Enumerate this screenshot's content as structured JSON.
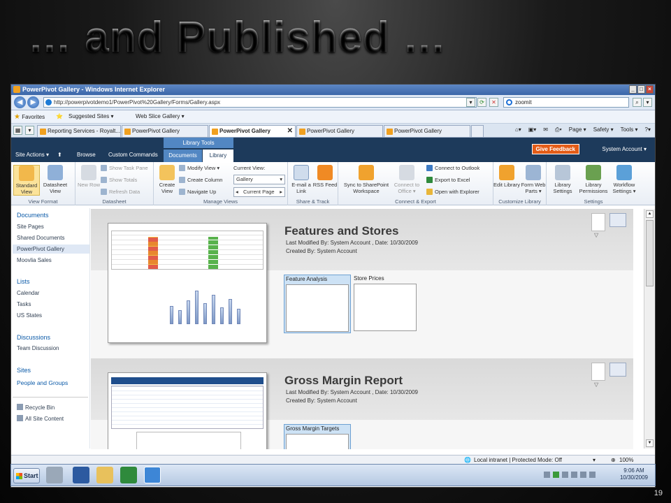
{
  "slide": {
    "title": "… and Published …",
    "number": "19"
  },
  "browser": {
    "window_title": "PowerPivot Gallery - Windows Internet Explorer",
    "url": "http://powerpivotdemo1/PowerPivot%20Gallery/Forms/Gallery.aspx",
    "search_value": "zoomit",
    "favorites_label": "Favorites",
    "suggested_sites": "Suggested Sites ▾",
    "web_slice": "Web Slice Gallery ▾",
    "tabs": [
      {
        "label": "Reporting Services - Royalt..."
      },
      {
        "label": "PowerPivot Gallery"
      },
      {
        "label": "PowerPivot Gallery"
      },
      {
        "label": "PowerPivot Gallery"
      },
      {
        "label": "PowerPivot Gallery"
      }
    ],
    "command_bar": {
      "page": "Page ▾",
      "safety": "Safety ▾",
      "tools": "Tools ▾"
    }
  },
  "sharepoint": {
    "site_actions": "Site Actions ▾",
    "library_tools": "Library Tools",
    "tab_browse": "Browse",
    "tab_custom": "Custom Commands",
    "tab_documents": "Documents",
    "tab_library": "Library",
    "give_feedback": "Give Feedback",
    "user": "System Account ▾"
  },
  "ribbon": {
    "view_format": {
      "label": "View Format",
      "standard_view": "Standard View",
      "datasheet_view": "Datasheet View"
    },
    "datasheet": {
      "label": "Datasheet",
      "new_row": "New Row",
      "show_task_pane": "Show Task Pane",
      "show_totals": "Show Totals",
      "refresh_data": "Refresh Data"
    },
    "manage_views": {
      "label": "Manage Views",
      "create_view": "Create View",
      "modify_view": "Modify View ▾",
      "create_column": "Create Column",
      "navigate_up": "Navigate Up",
      "current_view_label": "Current View:",
      "current_view_value": "Gallery",
      "current_page": "Current Page"
    },
    "share_track": {
      "label": "Share & Track",
      "email_link": "E-mail a Link",
      "rss_feed": "RSS Feed"
    },
    "connect_export": {
      "label": "Connect & Export",
      "sync": "Sync to SharePoint Workspace",
      "connect_office": "Connect to Office ▾",
      "connect_outlook": "Connect to Outlook",
      "export_excel": "Export to Excel",
      "open_explorer": "Open with Explorer"
    },
    "customize_library": {
      "label": "Customize Library",
      "edit_library": "Edit Library",
      "form_web_parts": "Form Web Parts ▾"
    },
    "settings": {
      "label": "Settings",
      "library_settings": "Library Settings",
      "library_permissions": "Library Permissions",
      "workflow_settings": "Workflow Settings ▾"
    }
  },
  "leftnav": {
    "documents": "Documents",
    "site_pages": "Site Pages",
    "shared_documents": "Shared Documents",
    "powerpivot_gallery": "PowerPivot Gallery",
    "moovlia_sales": "Moovlia Sales",
    "lists": "Lists",
    "calendar": "Calendar",
    "tasks": "Tasks",
    "us_states": "US States",
    "discussions": "Discussions",
    "team_discussion": "Team Discussion",
    "sites": "Sites",
    "people_groups": "People and Groups",
    "recycle_bin": "Recycle Bin",
    "all_site_content": "All Site Content"
  },
  "gallery": {
    "items": [
      {
        "title": "Features and Stores",
        "modified": "Last Modified By: System Account  ,  Date: 10/30/2009",
        "created": "Created By: System Account",
        "sheets": [
          "Feature Analysis",
          "Store Prices"
        ]
      },
      {
        "title": "Gross Margin Report",
        "modified": "Last Modified By: System Account  ,  Date: 10/30/2009",
        "created": "Created By: System Account",
        "sheets": [
          "Gross Margin Targets"
        ]
      }
    ]
  },
  "statusbar": {
    "zone": "Local intranet | Protected Mode: Off",
    "zoom": "100%"
  },
  "taskbar": {
    "start": "Start",
    "time": "9:06 AM",
    "date": "10/30/2009"
  }
}
